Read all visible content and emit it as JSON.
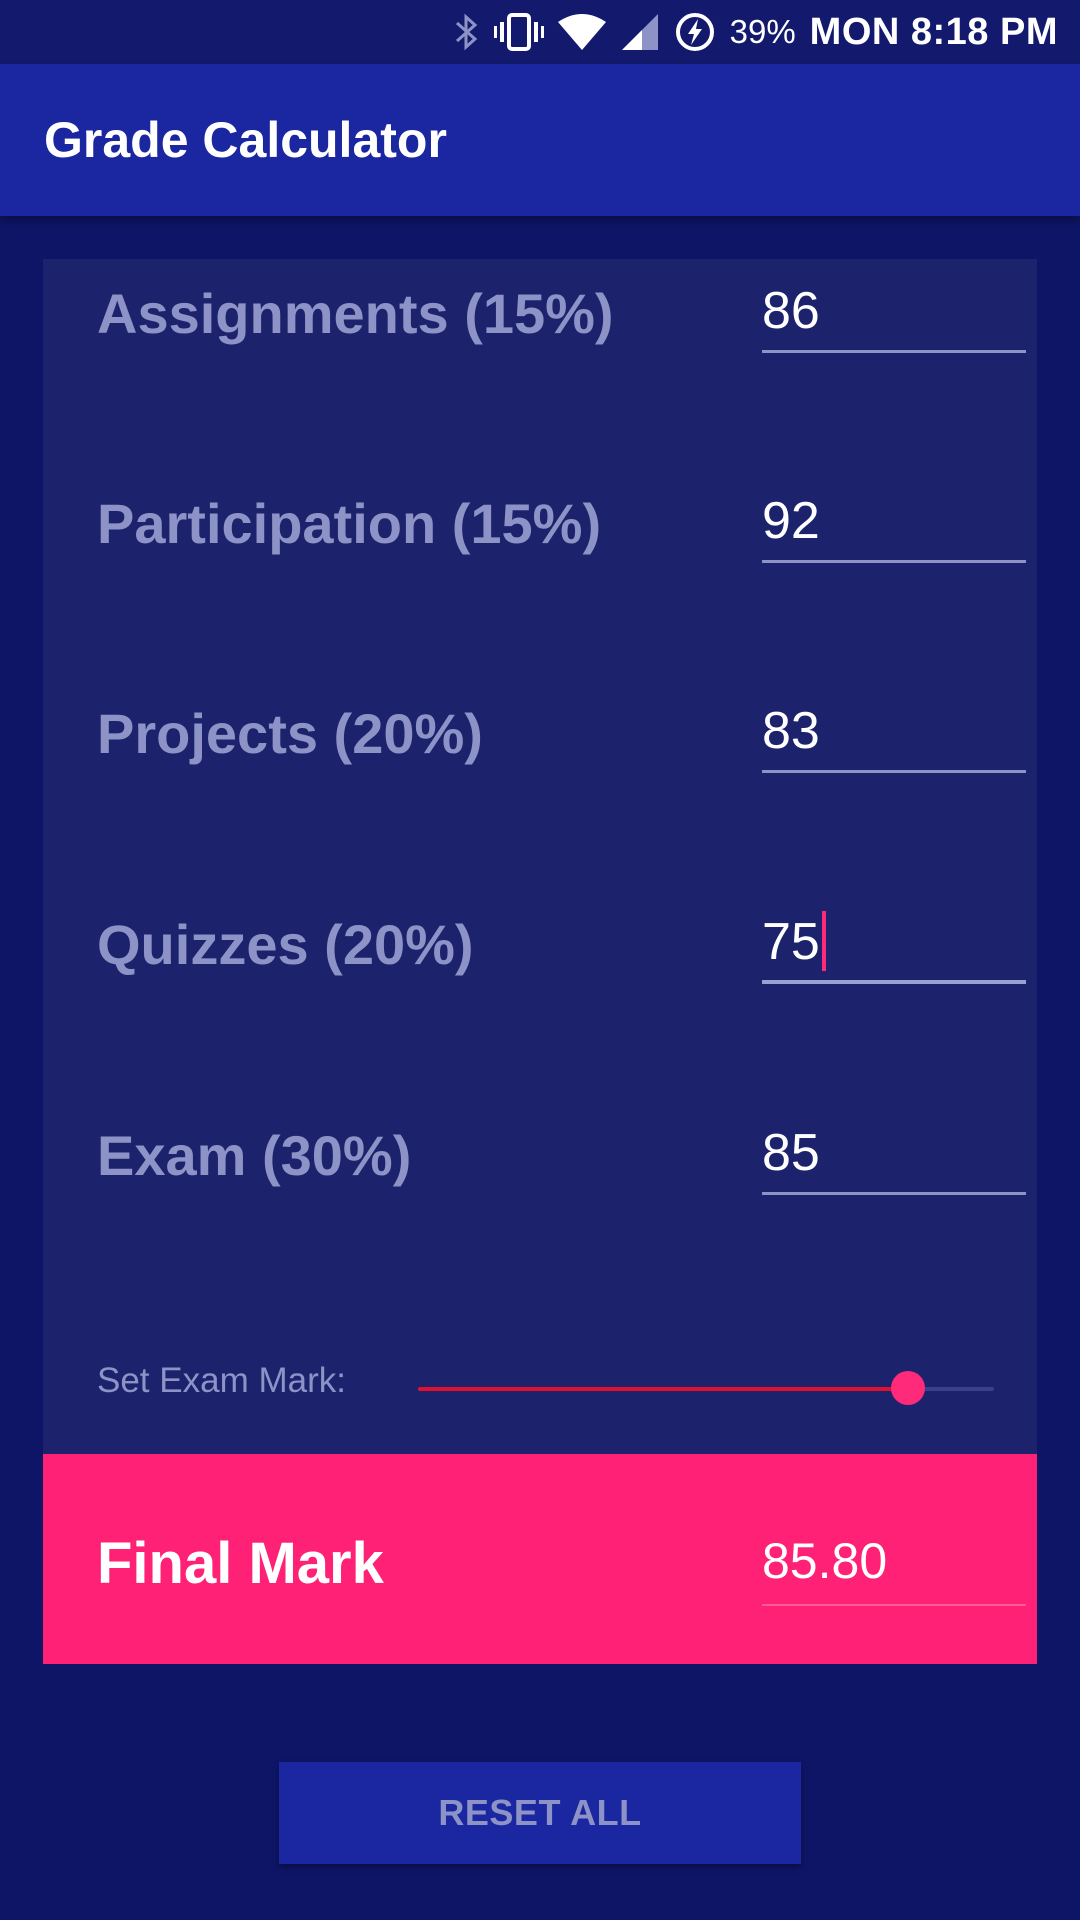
{
  "status_bar": {
    "icons": [
      "bluetooth-icon",
      "vibrate-icon",
      "wifi-icon",
      "signal-icon",
      "battery-charging-icon"
    ],
    "battery": "39%",
    "clock": "MON 8:18 PM"
  },
  "app_bar": {
    "title": "Grade Calculator"
  },
  "grades": [
    {
      "label": "Assignments (15%)",
      "value": "86"
    },
    {
      "label": "Participation (15%)",
      "value": "92"
    },
    {
      "label": "Projects (20%)",
      "value": "83"
    },
    {
      "label": "Quizzes (20%)",
      "value": "75"
    },
    {
      "label": "Exam (30%)",
      "value": "85"
    }
  ],
  "focused_field": "Quizzes (20%)",
  "slider": {
    "label": "Set Exam Mark:",
    "value_fraction": 0.85
  },
  "final": {
    "label": "Final Mark",
    "value": "85.80"
  },
  "reset_button": {
    "label": "RESET ALL"
  },
  "colors": {
    "background": "#0e1566",
    "app_bar": "#1b27a1",
    "card": "#1c236c",
    "accent": "#ff2175",
    "slider_fill": "#e0112e"
  }
}
